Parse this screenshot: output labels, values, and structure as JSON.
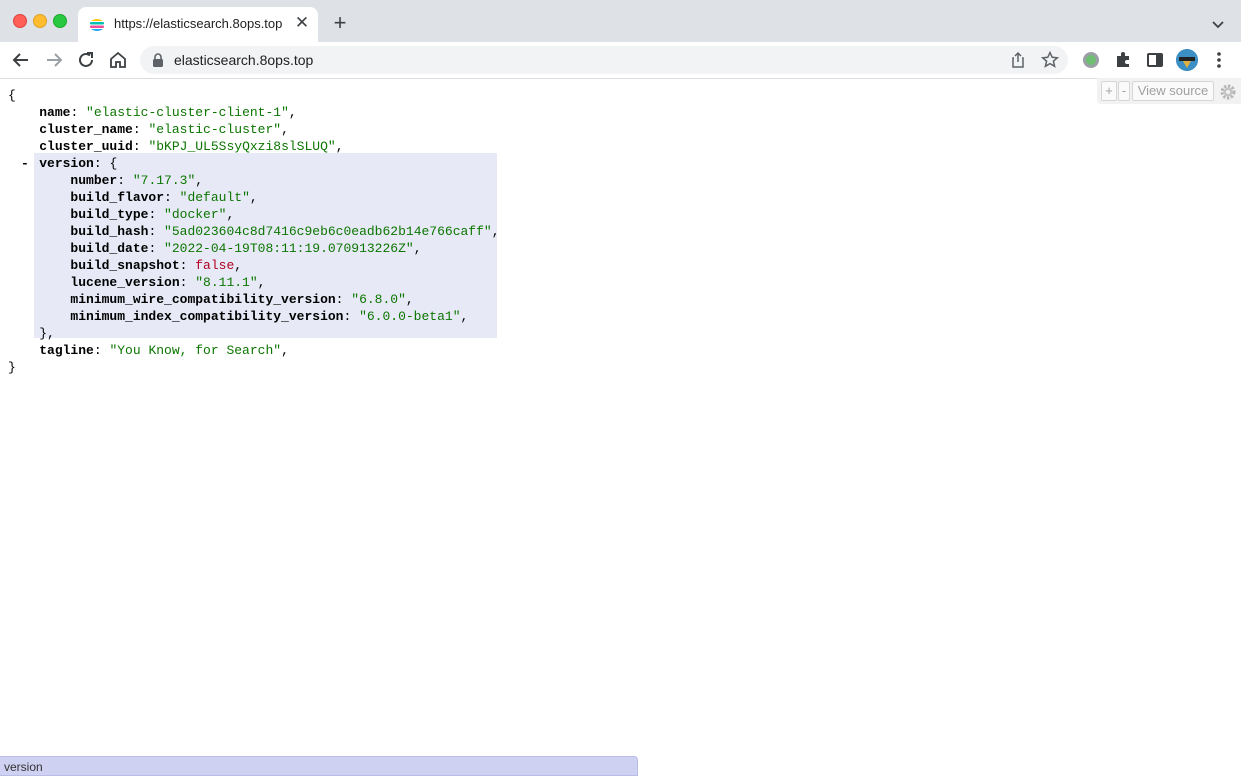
{
  "browser": {
    "tab_title": "https://elasticsearch.8ops.top",
    "tab_close": "✕",
    "new_tab": "+",
    "url": "elasticsearch.8ops.top"
  },
  "viewer": {
    "expand_label": "+",
    "collapse_label": "-",
    "view_source_label": "View source"
  },
  "json": {
    "open_brace": "{",
    "close_brace": "}",
    "collapse_marker": "-",
    "name": {
      "key": "name",
      "value": "\"elastic-cluster-client-1\""
    },
    "cluster_name": {
      "key": "cluster_name",
      "value": "\"elastic-cluster\""
    },
    "cluster_uuid": {
      "key": "cluster_uuid",
      "value": "\"bKPJ_UL5SsyQxzi8slSLUQ\""
    },
    "version": {
      "key": "version",
      "open": " {",
      "close": "},",
      "number": {
        "key": "number",
        "value": "\"7.17.3\""
      },
      "build_flavor": {
        "key": "build_flavor",
        "value": "\"default\""
      },
      "build_type": {
        "key": "build_type",
        "value": "\"docker\""
      },
      "build_hash": {
        "key": "build_hash",
        "value": "\"5ad023604c8d7416c9eb6c0eadb62b14e766caff\""
      },
      "build_date": {
        "key": "build_date",
        "value": "\"2022-04-19T08:11:19.070913226Z\""
      },
      "build_snapshot": {
        "key": "build_snapshot",
        "value": "false"
      },
      "lucene_version": {
        "key": "lucene_version",
        "value": "\"8.11.1\""
      },
      "minimum_wire_compatibility_version": {
        "key": "minimum_wire_compatibility_version",
        "value": "\"6.8.0\""
      },
      "minimum_index_compatibility_version": {
        "key": "minimum_index_compatibility_version",
        "value": "\"6.0.0-beta1\""
      }
    },
    "tagline": {
      "key": "tagline",
      "value": "\"You Know, for Search\""
    }
  },
  "status_bar": {
    "text": "version"
  },
  "colors": {
    "string": "#0b7500",
    "boolean": "#b00020",
    "highlight": "#e7eaf6",
    "status_bar": "#cfd1f2"
  }
}
